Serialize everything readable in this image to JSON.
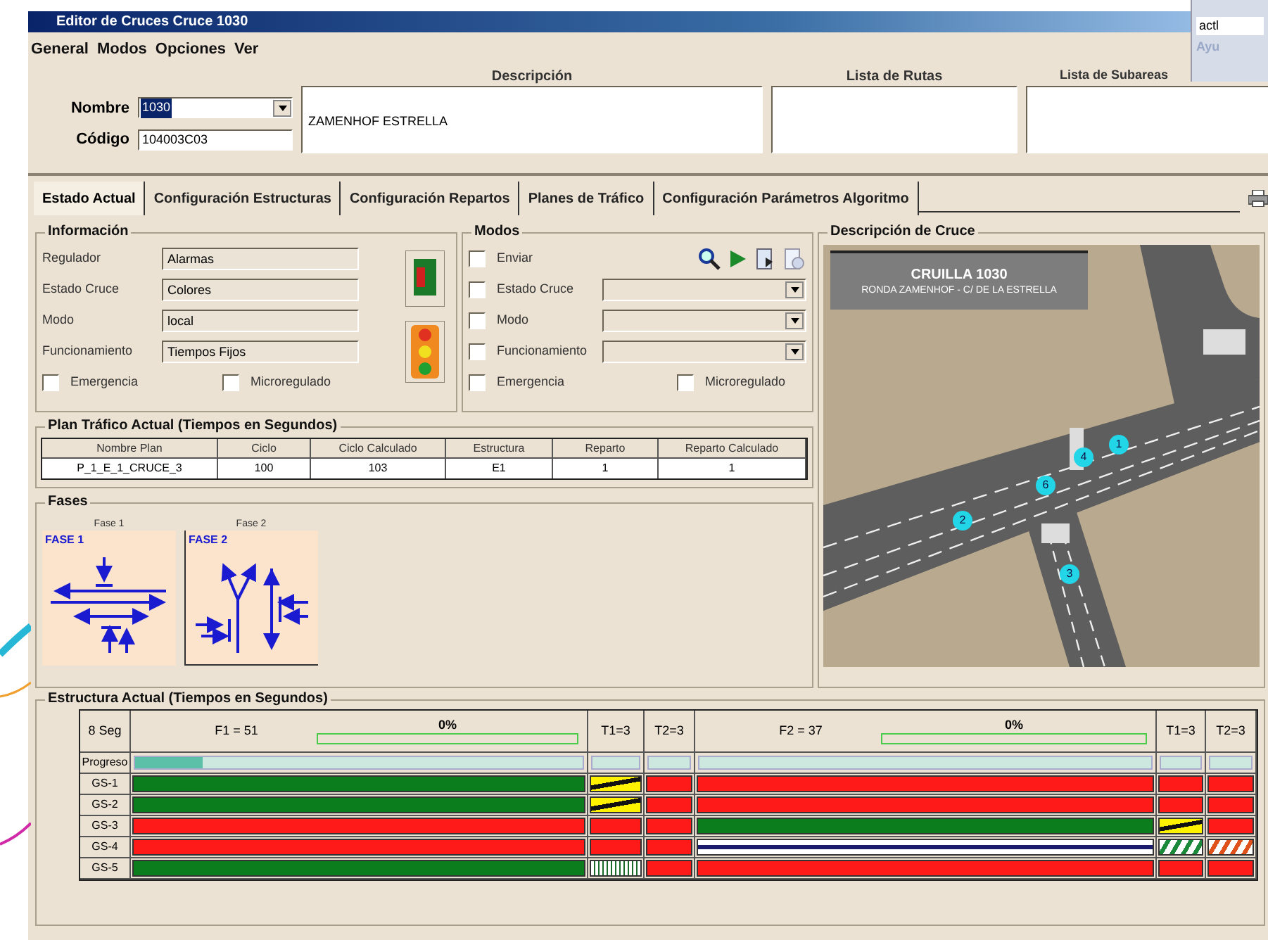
{
  "window": {
    "title": "Editor de Cruces  Cruce 1030"
  },
  "search_panel": {
    "value": "actl",
    "link": "Ayu"
  },
  "menu": [
    "General",
    "Modos",
    "Opciones",
    "Ver"
  ],
  "header": {
    "nombre_label": "Nombre",
    "nombre_value": "1030",
    "codigo_label": "Código",
    "codigo_value": "104003C03",
    "descripcion_label": "Descripción",
    "descripcion_value": "ZAMENHOF  ESTRELLA",
    "rutas_label": "Lista de Rutas",
    "subareas_label": "Lista de Subareas"
  },
  "tabs": [
    {
      "label": "Estado Actual",
      "selected": true
    },
    {
      "label": "Configuración Estructuras",
      "selected": false
    },
    {
      "label": "Configuración Repartos",
      "selected": false
    },
    {
      "label": "Planes de Tráfico",
      "selected": false
    },
    {
      "label": "Configuración Parámetros Algoritmo",
      "selected": false
    }
  ],
  "informacion": {
    "title": "Información",
    "fields": [
      {
        "label": "Regulador",
        "value": "Alarmas"
      },
      {
        "label": "Estado Cruce",
        "value": "Colores"
      },
      {
        "label": "Modo",
        "value": "local"
      },
      {
        "label": "Funcionamiento",
        "value": "Tiempos Fijos"
      }
    ],
    "checks": [
      {
        "label": "Emergencia",
        "checked": false
      },
      {
        "label": "Microregulado",
        "checked": false
      }
    ]
  },
  "modos": {
    "title": "Modos",
    "rows": [
      {
        "kind": "tools",
        "label": "Enviar",
        "checked": false
      },
      {
        "kind": "select",
        "label": "Estado Cruce",
        "checked": false
      },
      {
        "kind": "select",
        "label": "Modo",
        "checked": false
      },
      {
        "kind": "select",
        "label": "Funcionamiento",
        "checked": false
      }
    ],
    "checks": [
      {
        "label": "Emergencia",
        "checked": false
      },
      {
        "label": "Microregulado",
        "checked": false
      }
    ]
  },
  "plan": {
    "title": "Plan Tráfico Actual (Tiempos en Segundos)",
    "columns": [
      "Nombre Plan",
      "Ciclo",
      "Ciclo Calculado",
      "Estructura",
      "Reparto",
      "Reparto Calculado"
    ],
    "row": [
      "P_1_E_1_CRUCE_3",
      "100",
      "103",
      "E1",
      "1",
      "1"
    ]
  },
  "fases": {
    "title": "Fases",
    "items": [
      {
        "caption": "Fase 1",
        "label": "FASE 1",
        "kind": "fase1",
        "selected": false
      },
      {
        "caption": "Fase 2",
        "label": "FASE 2",
        "kind": "fase2",
        "selected": true
      }
    ]
  },
  "cruce": {
    "title": "Descripción de Cruce",
    "sign_title": "CRUILLA 1030",
    "sign_subtitle": "RONDA ZAMENHOF - C/ DE LA ESTRELLA",
    "markers": [
      "1",
      "4",
      "6",
      "2",
      "3"
    ]
  },
  "estructura": {
    "title": "Estructura Actual (Tiempos en Segundos)",
    "corner": "8 Seg",
    "phases": [
      {
        "kind": "fase",
        "label": "F1 = 51",
        "percent": "0%",
        "level": 0
      },
      {
        "kind": "trans",
        "label": "T1=3"
      },
      {
        "kind": "trans",
        "label": "T2=3"
      },
      {
        "kind": "fase",
        "label": "F2 = 37",
        "percent": "0%",
        "level": 0
      },
      {
        "kind": "trans",
        "label": "T1=3"
      },
      {
        "kind": "trans",
        "label": "T2=3"
      }
    ],
    "progress_label": "Progreso",
    "progress": [
      {
        "level": 0.15
      },
      {
        "level": 0
      },
      {
        "level": 0
      },
      {
        "level": 0
      },
      {
        "level": 0
      },
      {
        "level": 0
      }
    ],
    "rows": [
      {
        "label": "GS-1",
        "cells": [
          {
            "kind": "green"
          },
          {
            "kind": "amber"
          },
          {
            "kind": "red"
          },
          {
            "kind": "red"
          },
          {
            "kind": "red"
          },
          {
            "kind": "red"
          }
        ]
      },
      {
        "label": "GS-2",
        "cells": [
          {
            "kind": "green"
          },
          {
            "kind": "amber"
          },
          {
            "kind": "red"
          },
          {
            "kind": "red"
          },
          {
            "kind": "red"
          },
          {
            "kind": "red"
          }
        ]
      },
      {
        "label": "GS-3",
        "cells": [
          {
            "kind": "red"
          },
          {
            "kind": "red"
          },
          {
            "kind": "red"
          },
          {
            "kind": "green"
          },
          {
            "kind": "amber"
          },
          {
            "kind": "red"
          }
        ]
      },
      {
        "label": "GS-4",
        "cells": [
          {
            "kind": "red"
          },
          {
            "kind": "red"
          },
          {
            "kind": "red"
          },
          {
            "kind": "blank"
          },
          {
            "kind": "green-flash"
          },
          {
            "kind": "red-flash"
          }
        ]
      },
      {
        "label": "GS-5",
        "cells": [
          {
            "kind": "green"
          },
          {
            "kind": "green-bars"
          },
          {
            "kind": "red"
          },
          {
            "kind": "red"
          },
          {
            "kind": "red"
          },
          {
            "kind": "red"
          }
        ]
      }
    ]
  }
}
